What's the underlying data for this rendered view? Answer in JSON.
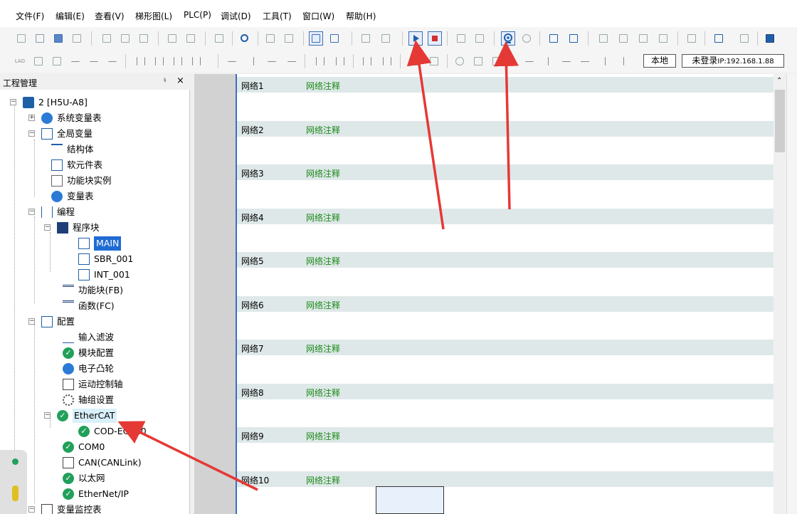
{
  "menu": [
    "文件(F)",
    "编辑(E)",
    "查看(V)",
    "梯形图(L)",
    "PLC(P)",
    "调试(D)",
    "工具(T)",
    "窗口(W)",
    "帮助(H)"
  ],
  "toolbar": {
    "local_label": "本地",
    "login_label": "未登录",
    "ip_label": "IP:192.168.1.88",
    "lad_label": "LAD"
  },
  "panel": {
    "title": "工程管理",
    "pin_icon": "pin-icon",
    "close_label": "×"
  },
  "tree": {
    "root": "2 [H5U-A8]",
    "sys_vars": "系统变量表",
    "global_vars": "全局变量",
    "struct": "结构体",
    "soft_elements": "软元件表",
    "fb_instance": "功能块实例",
    "var_table": "变量表",
    "programming": "编程",
    "program_blocks": "程序块",
    "main": "MAIN",
    "sbr": "SBR_001",
    "int": "INT_001",
    "fb": "功能块(FB)",
    "fc": "函数(FC)",
    "config": "配置",
    "input_filter": "输入滤波",
    "module_config": "模块配置",
    "ecam": "电子凸轮",
    "motion_axis": "运动控制轴",
    "axis_group": "轴组设置",
    "ethercat": "EtherCAT",
    "cod": "COD-EC-4.0",
    "com0": "COM0",
    "can": "CAN(CANLink)",
    "ethernet": "以太网",
    "ethernet_ip": "EtherNet/IP",
    "monitor": "变量监控表"
  },
  "networks": [
    {
      "name": "网络1",
      "comment": "网络注释"
    },
    {
      "name": "网络2",
      "comment": "网络注释"
    },
    {
      "name": "网络3",
      "comment": "网络注释"
    },
    {
      "name": "网络4",
      "comment": "网络注释"
    },
    {
      "name": "网络5",
      "comment": "网络注释"
    },
    {
      "name": "网络6",
      "comment": "网络注释"
    },
    {
      "name": "网络7",
      "comment": "网络注释"
    },
    {
      "name": "网络8",
      "comment": "网络注释"
    },
    {
      "name": "网络9",
      "comment": "网络注释"
    },
    {
      "name": "网络10",
      "comment": "网络注释"
    }
  ],
  "colors": {
    "arrow": "#e53935",
    "accent": "#3b6fb6",
    "check": "#22a05a",
    "comment": "#1a8a1a"
  }
}
